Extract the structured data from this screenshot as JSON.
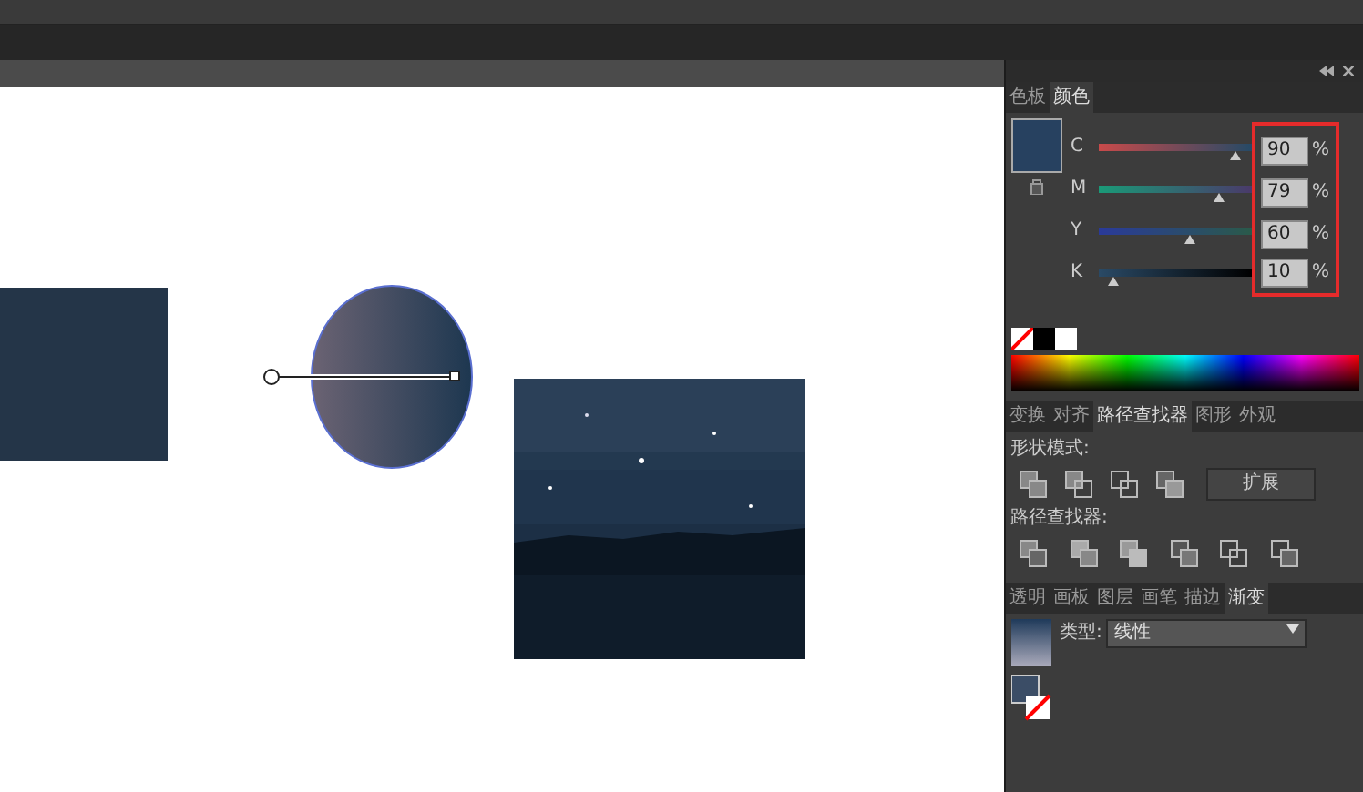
{
  "color_panel": {
    "tabs": [
      {
        "label": "色板",
        "selected": false
      },
      {
        "label": "颜色",
        "selected": true
      }
    ],
    "channels": [
      {
        "name": "C",
        "level": 0.9,
        "value": "90",
        "unit": "%"
      },
      {
        "name": "M",
        "level": 0.79,
        "value": "79",
        "unit": "%"
      },
      {
        "name": "Y",
        "level": 0.6,
        "value": "60",
        "unit": "%"
      },
      {
        "name": "K",
        "level": 0.1,
        "value": "10",
        "unit": "%"
      }
    ]
  },
  "pathfinder_panel": {
    "tabs": [
      {
        "label": "变换",
        "selected": false
      },
      {
        "label": "对齐",
        "selected": false
      },
      {
        "label": "路径查找器",
        "selected": true
      },
      {
        "label": "图形",
        "selected": false
      },
      {
        "label": "外观",
        "selected": false
      }
    ],
    "shape_modes_label": "形状模式:",
    "expand_button": "扩展",
    "pathfinders_label": "路径查找器:"
  },
  "gradient_panel": {
    "tabs": [
      {
        "label": "透明",
        "selected": false
      },
      {
        "label": "画板",
        "selected": false
      },
      {
        "label": "图层",
        "selected": false
      },
      {
        "label": "画笔",
        "selected": false
      },
      {
        "label": "描边",
        "selected": false
      },
      {
        "label": "渐变",
        "selected": true
      }
    ],
    "type_label": "类型:",
    "type_value": "线性"
  }
}
